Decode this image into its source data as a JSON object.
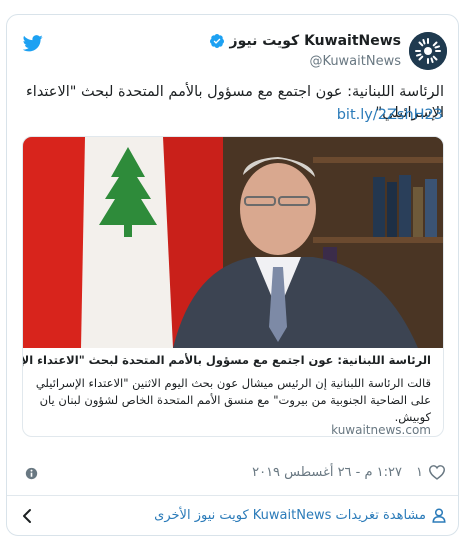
{
  "header": {
    "display_name": "KuwaitNews كويت نيوز",
    "handle": "@KuwaitNews"
  },
  "tweet": {
    "text": "الرئاسة اللبنانية: عون اجتمع مع مسؤول بالأمم المتحدة لبحث \"الاعتداء الإسرائيلي\"",
    "link": "bit.ly/2ZshH23"
  },
  "card": {
    "title": "الرئاسة اللبنانية: عون اجتمع مع مسؤول بالأمم المتحدة لبحث \"الاعتداء الإسرائيلي\"",
    "description": "قالت الرئاسة اللبنانية إن الرئيس ميشال عون بحث اليوم الاثنين \"الاعتداء الإسرائيلي على الضاحية الجنوبية من بيروت\" مع منسق الأمم المتحدة الخاص لشؤون لبنان يان كوبيش.",
    "domain": "kuwaitnews.com"
  },
  "meta": {
    "like_count": "١",
    "timestamp": "١:٢٧ م - ٢٦ أغسطس ٢٠١٩"
  },
  "footer": {
    "more_link": "مشاهدة تغريدات KuwaitNews كويت نيوز الأخرى"
  },
  "colors": {
    "link": "#2b7bb9",
    "muted": "#697882",
    "twitter_blue": "#1da1f2",
    "heart": "#697882"
  },
  "icons": [
    "twitter-bird-icon",
    "verified-badge-icon",
    "heart-icon",
    "info-icon",
    "person-icon",
    "chevron-left-icon"
  ]
}
